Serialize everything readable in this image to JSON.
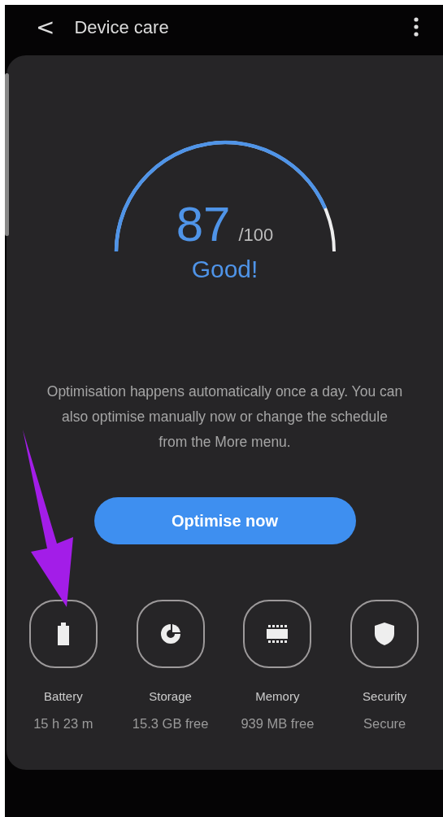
{
  "header": {
    "title": "Device care",
    "back": "<"
  },
  "gauge": {
    "score": "87",
    "max": "/100",
    "status": "Good!"
  },
  "description": "Optimisation happens automatically once a day. You can also optimise manually now or change the schedule from the More menu.",
  "button": "Optimise now",
  "items": [
    {
      "kind": "battery",
      "label": "Battery",
      "value": "15 h 23 m"
    },
    {
      "kind": "storage",
      "label": "Storage",
      "value": "15.3 GB free"
    },
    {
      "kind": "memory",
      "label": "Memory",
      "value": "939 MB free"
    },
    {
      "kind": "security",
      "label": "Security",
      "value": "Secure"
    }
  ]
}
